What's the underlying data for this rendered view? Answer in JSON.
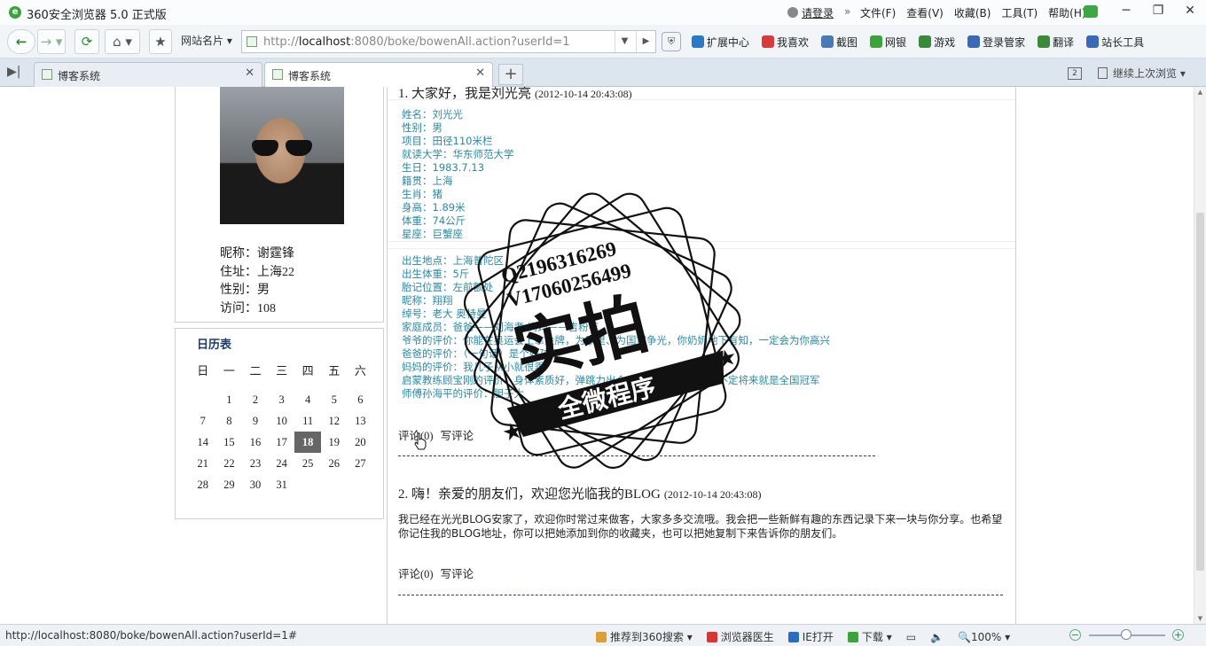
{
  "window": {
    "title": "360安全浏览器 5.0 正式版",
    "login": "请登录",
    "menu": [
      "文件(F)",
      "查看(V)",
      "收藏(B)",
      "工具(T)",
      "帮助(H)"
    ]
  },
  "toolbar": {
    "site_card": "网站名片",
    "url_prefix": "http://",
    "url_host": "localhost",
    "url_rest": ":8080/boke/bowenAll.action?userId=1",
    "extensions": [
      {
        "label": "扩展中心",
        "color": "#2b78c5"
      },
      {
        "label": "我喜欢",
        "color": "#d93a3a"
      },
      {
        "label": "截图",
        "color": "#4a7ab5"
      },
      {
        "label": "网银",
        "color": "#3aa33a"
      },
      {
        "label": "游戏",
        "color": "#3a8a3a"
      },
      {
        "label": "登录管家",
        "color": "#3a6ab5"
      },
      {
        "label": "翻译",
        "color": "#3a8a3a"
      },
      {
        "label": "站长工具",
        "color": "#3a6ab5"
      }
    ]
  },
  "tabs": [
    {
      "label": "博客系统"
    },
    {
      "label": "博客系统"
    }
  ],
  "tabbar": {
    "count": "2",
    "resume": "继续上次浏览"
  },
  "profile": {
    "nickname": "昵称：谢霆锋",
    "address": "住址：上海22",
    "gender": "性别：男",
    "visits": "访问：108"
  },
  "calendar": {
    "title": "日历表",
    "weekdays": [
      "日",
      "一",
      "二",
      "三",
      "四",
      "五",
      "六"
    ],
    "weeks": [
      [
        "",
        "1",
        "2",
        "3",
        "4",
        "5",
        "6"
      ],
      [
        "7",
        "8",
        "9",
        "10",
        "11",
        "12",
        "13"
      ],
      [
        "14",
        "15",
        "16",
        "17",
        "18",
        "19",
        "20"
      ],
      [
        "21",
        "22",
        "23",
        "24",
        "25",
        "26",
        "27"
      ],
      [
        "28",
        "29",
        "30",
        "31",
        "",
        "",
        ""
      ]
    ],
    "today": "18"
  },
  "posts": [
    {
      "title": "1. 大家好，我是刘光亮",
      "date": "(2012-10-14 20:43:08)",
      "lines_a": [
        "姓名：刘光光",
        "性别：男",
        "项目：田径110米栏",
        "就读大学：华东师范大学",
        "生日：1983.7.13",
        "籍贯：上海",
        "生肖：猪",
        "身高：1.89米",
        "体重：74公斤",
        "星座：巨蟹座"
      ],
      "lines_b": [
        "出生地点：上海普陀区",
        "出生体重：5斤",
        "胎记位置：左前额处",
        "昵称：翔翔",
        "绰号：老大 奥特曼",
        "家庭成员：爸爸——刘海孝 妈妈——吉粉花",
        "爷爷的评价：你能在奥运会上拿金牌，为家里、为国家争光，你奶奶地下有知，一定会为你高兴",
        "爸爸的评价：（一句话）是个好孩子",
        "妈妈的评价：我儿子从小就很乖",
        "启蒙教练顾宝刚的评价：身体素质好，弹跳力出众，适合练习跨栏，说不定将来就是全国冠军",
        "师傅孙海平的评价：胆子大"
      ],
      "comment": "评论(0)",
      "write": "写评论"
    },
    {
      "title": "2. 嗨！亲爱的朋友们，欢迎您光临我的BLOG",
      "date": "(2012-10-14 20:43:08)",
      "body": "我已经在光光BLOG安家了，欢迎你时常过来做客，大家多多交流哦。我会把一些新鲜有趣的东西记录下来一块与你分享。也希望你记住我的BLOG地址，你可以把她添加到你的收藏夹，也可以把她复制下来告诉你的朋友们。",
      "comment": "评论(0)",
      "write": "写评论"
    }
  ],
  "watermark": {
    "line1": "Q2196316269",
    "line2": "V17060256499",
    "big": "实拍",
    "banner": "全微程序"
  },
  "statusbar": {
    "url": "http://localhost:8080/boke/bowenAll.action?userId=1#",
    "recommend": "推荐到360搜索",
    "doctor": "浏览器医生",
    "ie": "IE打开",
    "download": "下载",
    "zoom": "100%"
  }
}
